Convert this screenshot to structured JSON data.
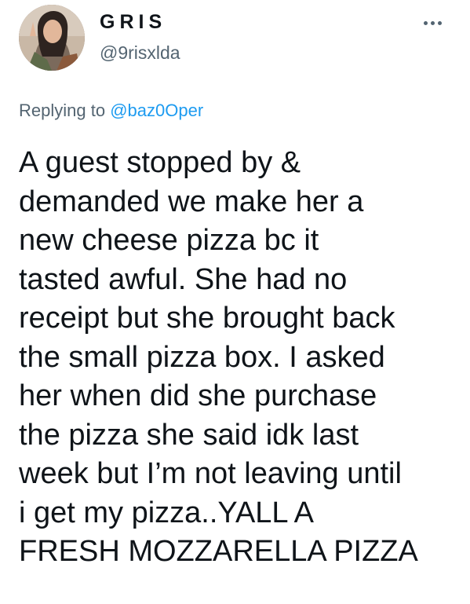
{
  "author": {
    "display_name": "GRIS",
    "handle": "@9risxlda",
    "avatar_icon": "profile-photo"
  },
  "reply": {
    "prefix": "Replying to",
    "mention": "@baz0Oper"
  },
  "more_icon": "more-horizontal-icon",
  "tweet": {
    "lines": [
      "A guest stopped by &",
      "demanded we make her a",
      "new cheese pizza bc it",
      "tasted awful. She had no",
      "receipt but she brought back",
      "the small pizza box. I asked",
      "her when did she purchase",
      "the pizza she said idk last",
      "week but I’m not leaving until",
      "i get my pizza..YALL A",
      "FRESH MOZZARELLA PIZZA"
    ]
  },
  "colors": {
    "text": "#0f1419",
    "secondary": "#536471",
    "link": "#1d9bf0",
    "background": "#ffffff"
  }
}
